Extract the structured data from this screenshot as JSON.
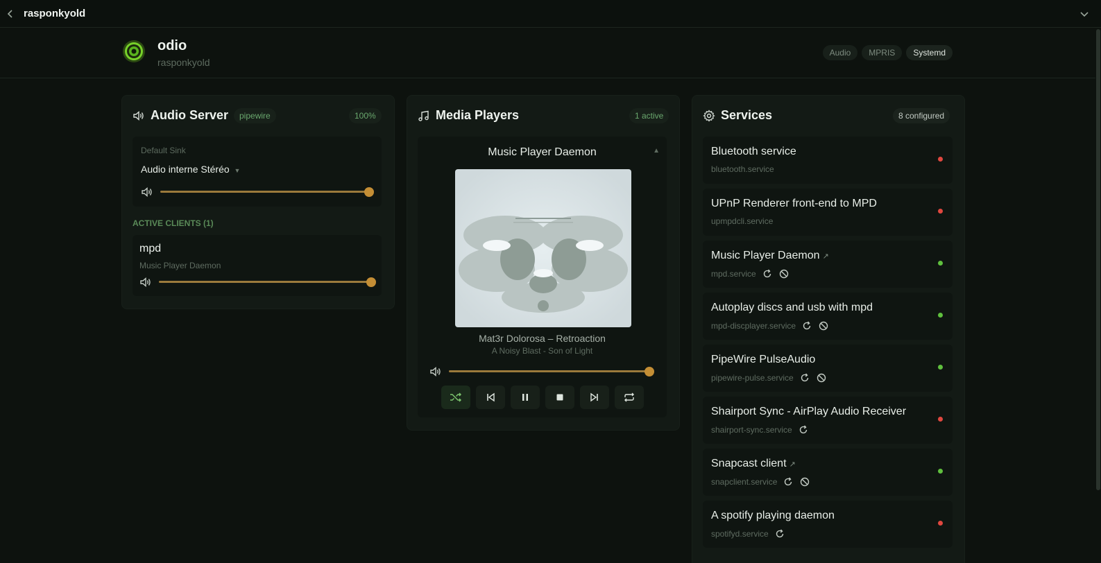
{
  "topbar": {
    "title": "rasponkyold"
  },
  "host": {
    "name": "odio",
    "subtitle": "rasponkyold",
    "badges": [
      "Audio",
      "MPRIS",
      "Systemd"
    ]
  },
  "audio_server": {
    "title": "Audio Server",
    "backend": "pipewire",
    "volume_text": "100%",
    "default_sink_label": "Default Sink",
    "sink_name": "Audio interne Stéréo",
    "sink_volume": 1.0,
    "clients_header": "ACTIVE CLIENTS (1)",
    "clients": [
      {
        "name": "mpd",
        "description": "Music Player Daemon",
        "volume": 1.0
      }
    ]
  },
  "media_players": {
    "title": "Media Players",
    "count_text": "1 active",
    "player": {
      "name": "Music Player Daemon",
      "track": "Mat3r Dolorosa – Retroaction",
      "album_line": "A Noisy Blast - Son of Light",
      "volume": 0.98,
      "controls": [
        "shuffle-icon",
        "previous-icon",
        "pause-icon",
        "stop-icon",
        "next-icon",
        "repeat-icon"
      ]
    }
  },
  "services": {
    "title": "Services",
    "count_text": "8 configured",
    "items": [
      {
        "name": "Bluetooth service",
        "unit": "bluetooth.service",
        "status": "stopped",
        "link": false,
        "restart": false,
        "disable": false
      },
      {
        "name": "UPnP Renderer front-end to MPD",
        "unit": "upmpdcli.service",
        "status": "stopped",
        "link": false,
        "restart": false,
        "disable": false
      },
      {
        "name": "Music Player Daemon",
        "unit": "mpd.service",
        "status": "running",
        "link": true,
        "restart": true,
        "disable": true
      },
      {
        "name": "Autoplay discs and usb with mpd",
        "unit": "mpd-discplayer.service",
        "status": "running",
        "link": false,
        "restart": true,
        "disable": true
      },
      {
        "name": "PipeWire PulseAudio",
        "unit": "pipewire-pulse.service",
        "status": "running",
        "link": false,
        "restart": true,
        "disable": true
      },
      {
        "name": "Shairport Sync - AirPlay Audio Receiver",
        "unit": "shairport-sync.service",
        "status": "stopped",
        "link": false,
        "restart": true,
        "disable": false
      },
      {
        "name": "Snapcast client",
        "unit": "snapclient.service",
        "status": "running",
        "link": true,
        "restart": true,
        "disable": true
      },
      {
        "name": "A spotify playing daemon",
        "unit": "spotifyd.service",
        "status": "stopped",
        "link": false,
        "restart": true,
        "disable": false
      }
    ]
  },
  "colors": {
    "running": "#5fbf3e",
    "stopped": "#e0473f",
    "accent": "#c48e35"
  }
}
